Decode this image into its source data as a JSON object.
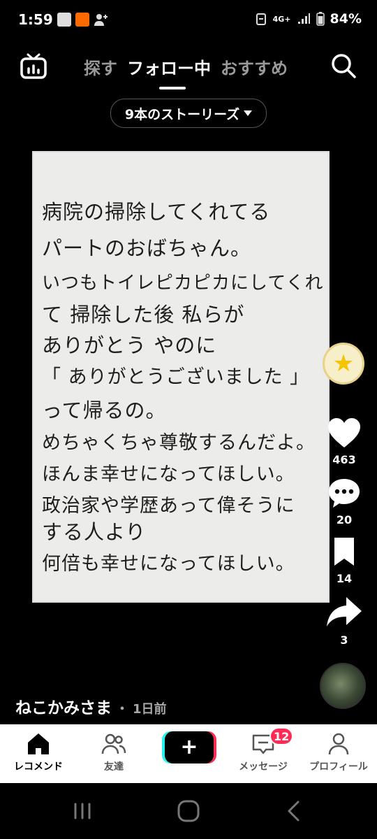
{
  "status_bar": {
    "time": "1:59",
    "mini_icon_text": "BAJIE\nTEMU",
    "network": "4G+",
    "battery": "84%"
  },
  "top_nav": {
    "tabs": [
      "探す",
      "フォロー中",
      "おすすめ"
    ],
    "active_tab_index": 1
  },
  "stories_pill": {
    "label": "9本のストーリーズ"
  },
  "note": {
    "lines": [
      "病院の掃除してくれてる",
      "パートのおばちゃん。",
      "いつもトイレピカピカにしてくれ",
      "て 掃除した後 私らが",
      "ありがとう やのに",
      "「 ありがとうございました 」",
      "って帰るの。",
      "めちゃくちゃ尊敬するんだよ。",
      "ほんま幸せになってほしい。",
      "政治家や学歴あって偉そうに",
      "する人より",
      "何倍も幸せになってほしい。"
    ]
  },
  "rail": {
    "likes": "463",
    "comments": "20",
    "saves": "14",
    "shares": "3"
  },
  "author": {
    "name": "ねこかみさま",
    "separator": "・",
    "time": "1日前"
  },
  "bottom_nav": {
    "home": "レコメンド",
    "friends": "友達",
    "messages": "メッセージ",
    "messages_badge": "12",
    "profile": "プロフィール"
  },
  "colors": {
    "accent_red": "#fe2c55",
    "accent_cyan": "#25f4ee"
  }
}
